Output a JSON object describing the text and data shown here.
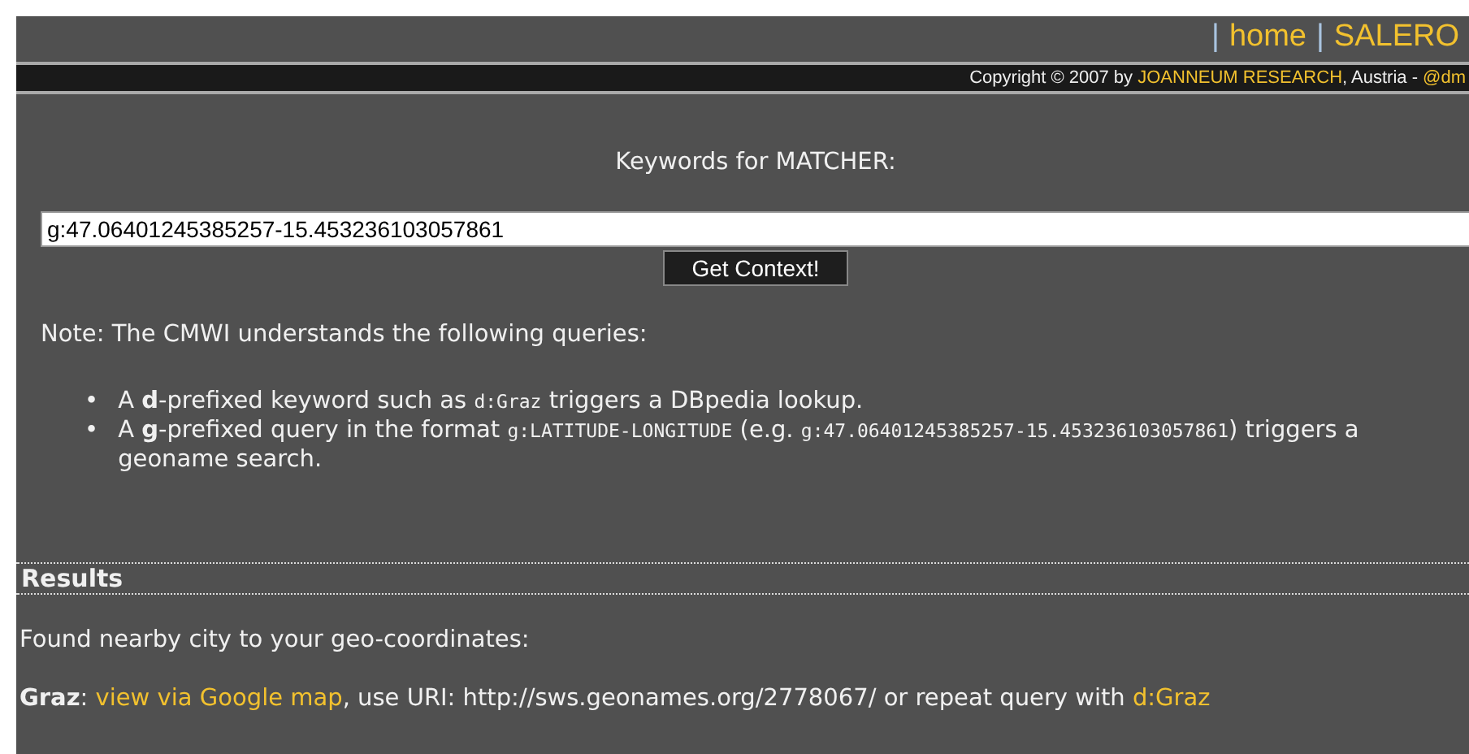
{
  "nav": [
    {
      "separator": "|",
      "label": "home"
    },
    {
      "separator": "|",
      "label": "SALERO"
    }
  ],
  "copyright": [
    {
      "kind": "text",
      "text": "Copyright © 2007 by "
    },
    {
      "kind": "link",
      "text": "JOANNEUM RESEARCH"
    },
    {
      "kind": "text",
      "text": ", Austria - "
    },
    {
      "kind": "link",
      "text": "@dm"
    }
  ],
  "form": {
    "label": "Keywords for MATCHER:",
    "value": "g:47.06401245385257-15.453236103057861",
    "button": "Get Context!"
  },
  "note": "Note: The CMWI understands the following queries:",
  "bullets": [
    {
      "marker": "•",
      "parts": [
        {
          "kind": "text",
          "text": "A "
        },
        {
          "kind": "bold",
          "text": "d"
        },
        {
          "kind": "text",
          "text": "-prefixed keyword such as "
        },
        {
          "kind": "code",
          "text": "d:Graz"
        },
        {
          "kind": "text",
          "text": " triggers a DBpedia lookup."
        }
      ]
    },
    {
      "marker": "•",
      "parts": [
        {
          "kind": "text",
          "text": "A "
        },
        {
          "kind": "bold",
          "text": "g"
        },
        {
          "kind": "text",
          "text": "-prefixed query in the format "
        },
        {
          "kind": "code",
          "text": "g:LATITUDE-LONGITUDE"
        },
        {
          "kind": "text",
          "text": " (e.g. "
        },
        {
          "kind": "code",
          "text": "g:47.06401245385257-15.453236103057861"
        },
        {
          "kind": "text",
          "text": ") triggers a geoname search."
        }
      ]
    }
  ],
  "results": {
    "heading": "Results",
    "intro": "Found nearby city to your geo-coordinates:",
    "line": [
      {
        "kind": "bold",
        "text": "Graz"
      },
      {
        "kind": "text",
        "text": ": "
      },
      {
        "kind": "link",
        "text": "view via Google map"
      },
      {
        "kind": "text",
        "text": ", use URI: http://sws.geonames.org/2778067/ or repeat query with "
      },
      {
        "kind": "link",
        "text": "d:Graz"
      }
    ]
  }
}
